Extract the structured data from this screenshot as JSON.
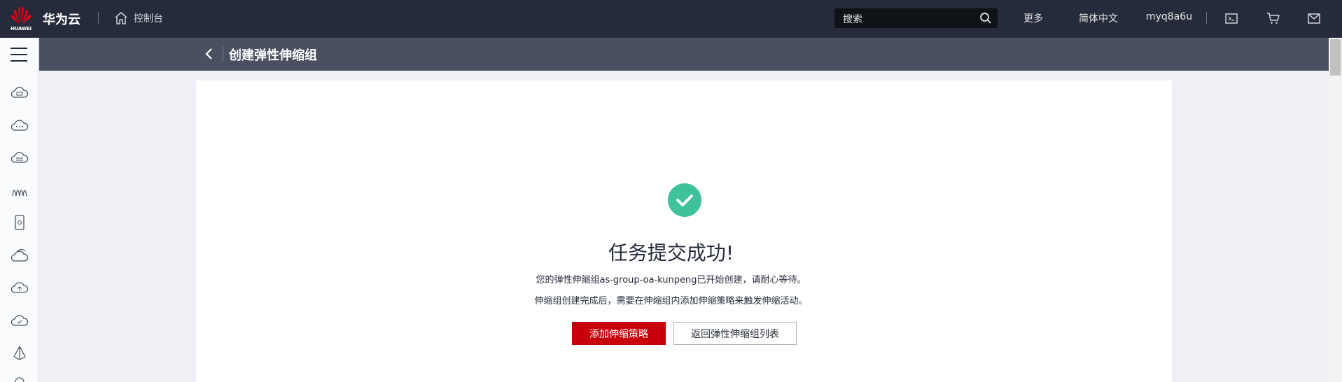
{
  "topbar": {
    "logo_text": "HUAWEI",
    "brand": "华为云",
    "console": "控制台",
    "search_placeholder": "搜索",
    "more": "更多",
    "language": "简体中文",
    "username": "myq8a6u"
  },
  "header": {
    "title": "创建弹性伸缩组"
  },
  "result": {
    "title": "任务提交成功!",
    "message1": "您的弹性伸缩组as-group-oa-kunpeng已开始创建，请耐心等待。",
    "message2": "伸缩组创建完成后，需要在伸缩组内添加伸缩策略来触发伸缩活动。",
    "primary_button": "添加伸缩策略",
    "secondary_button": "返回弹性伸缩组列表"
  },
  "colors": {
    "topbar": "#252b3a",
    "titlebar": "#4a5060",
    "accent": "#c7000b",
    "success": "#3fc29b"
  },
  "sidebar": {
    "icons": [
      "cloud-server-icon",
      "cloud-dots-icon",
      "cloud-grid-icon",
      "wave-icon",
      "device-icon",
      "cloud-layers-icon",
      "cloud-up-icon",
      "cloud-check-icon",
      "pyramid-icon"
    ]
  }
}
